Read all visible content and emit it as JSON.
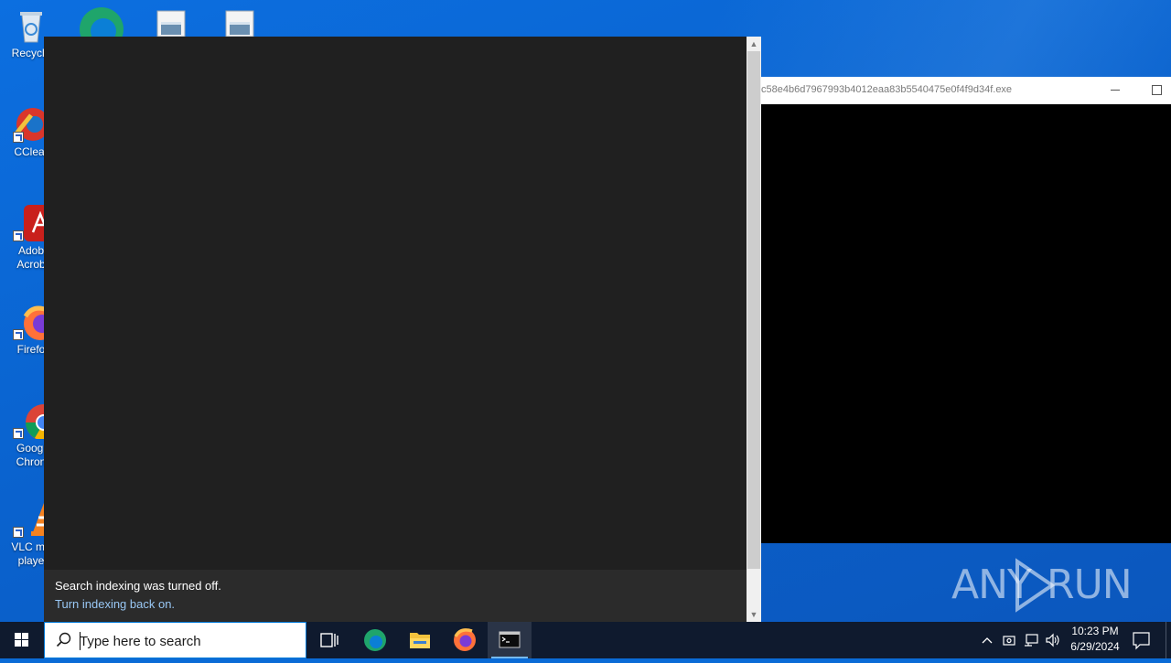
{
  "desktop": {
    "icons": [
      {
        "label": "Recycle",
        "icon": "recycle-bin-icon"
      },
      {
        "label": "CClear",
        "icon": "ccleaner-icon"
      },
      {
        "label": "Adob\nAcrob",
        "icon": "adobe-acrobat-icon"
      },
      {
        "label": "Firefo",
        "icon": "firefox-icon"
      },
      {
        "label": "Googl\nChron",
        "icon": "chrome-icon"
      },
      {
        "label": "VLC me\nplaye",
        "icon": "vlc-icon"
      }
    ],
    "top_icons": [
      "edge-icon",
      "image-file-icon",
      "image-file-icon"
    ]
  },
  "search_panel": {
    "notice_text": "Search indexing was turned off.",
    "notice_link": "Turn indexing back on."
  },
  "console": {
    "title": "c58e4b6d7967993b4012eaa83b5540475e0f4f9d34f.exe"
  },
  "watermark": {
    "left": "ANY",
    "right": "RUN"
  },
  "taskbar": {
    "search_placeholder": "Type here to search",
    "time": "10:23 PM",
    "date": "6/29/2024"
  },
  "colors": {
    "accent": "#0078d7",
    "link": "#99c8f5",
    "panel_bg": "#202020",
    "taskbar_bg": "#0f1a2e"
  }
}
